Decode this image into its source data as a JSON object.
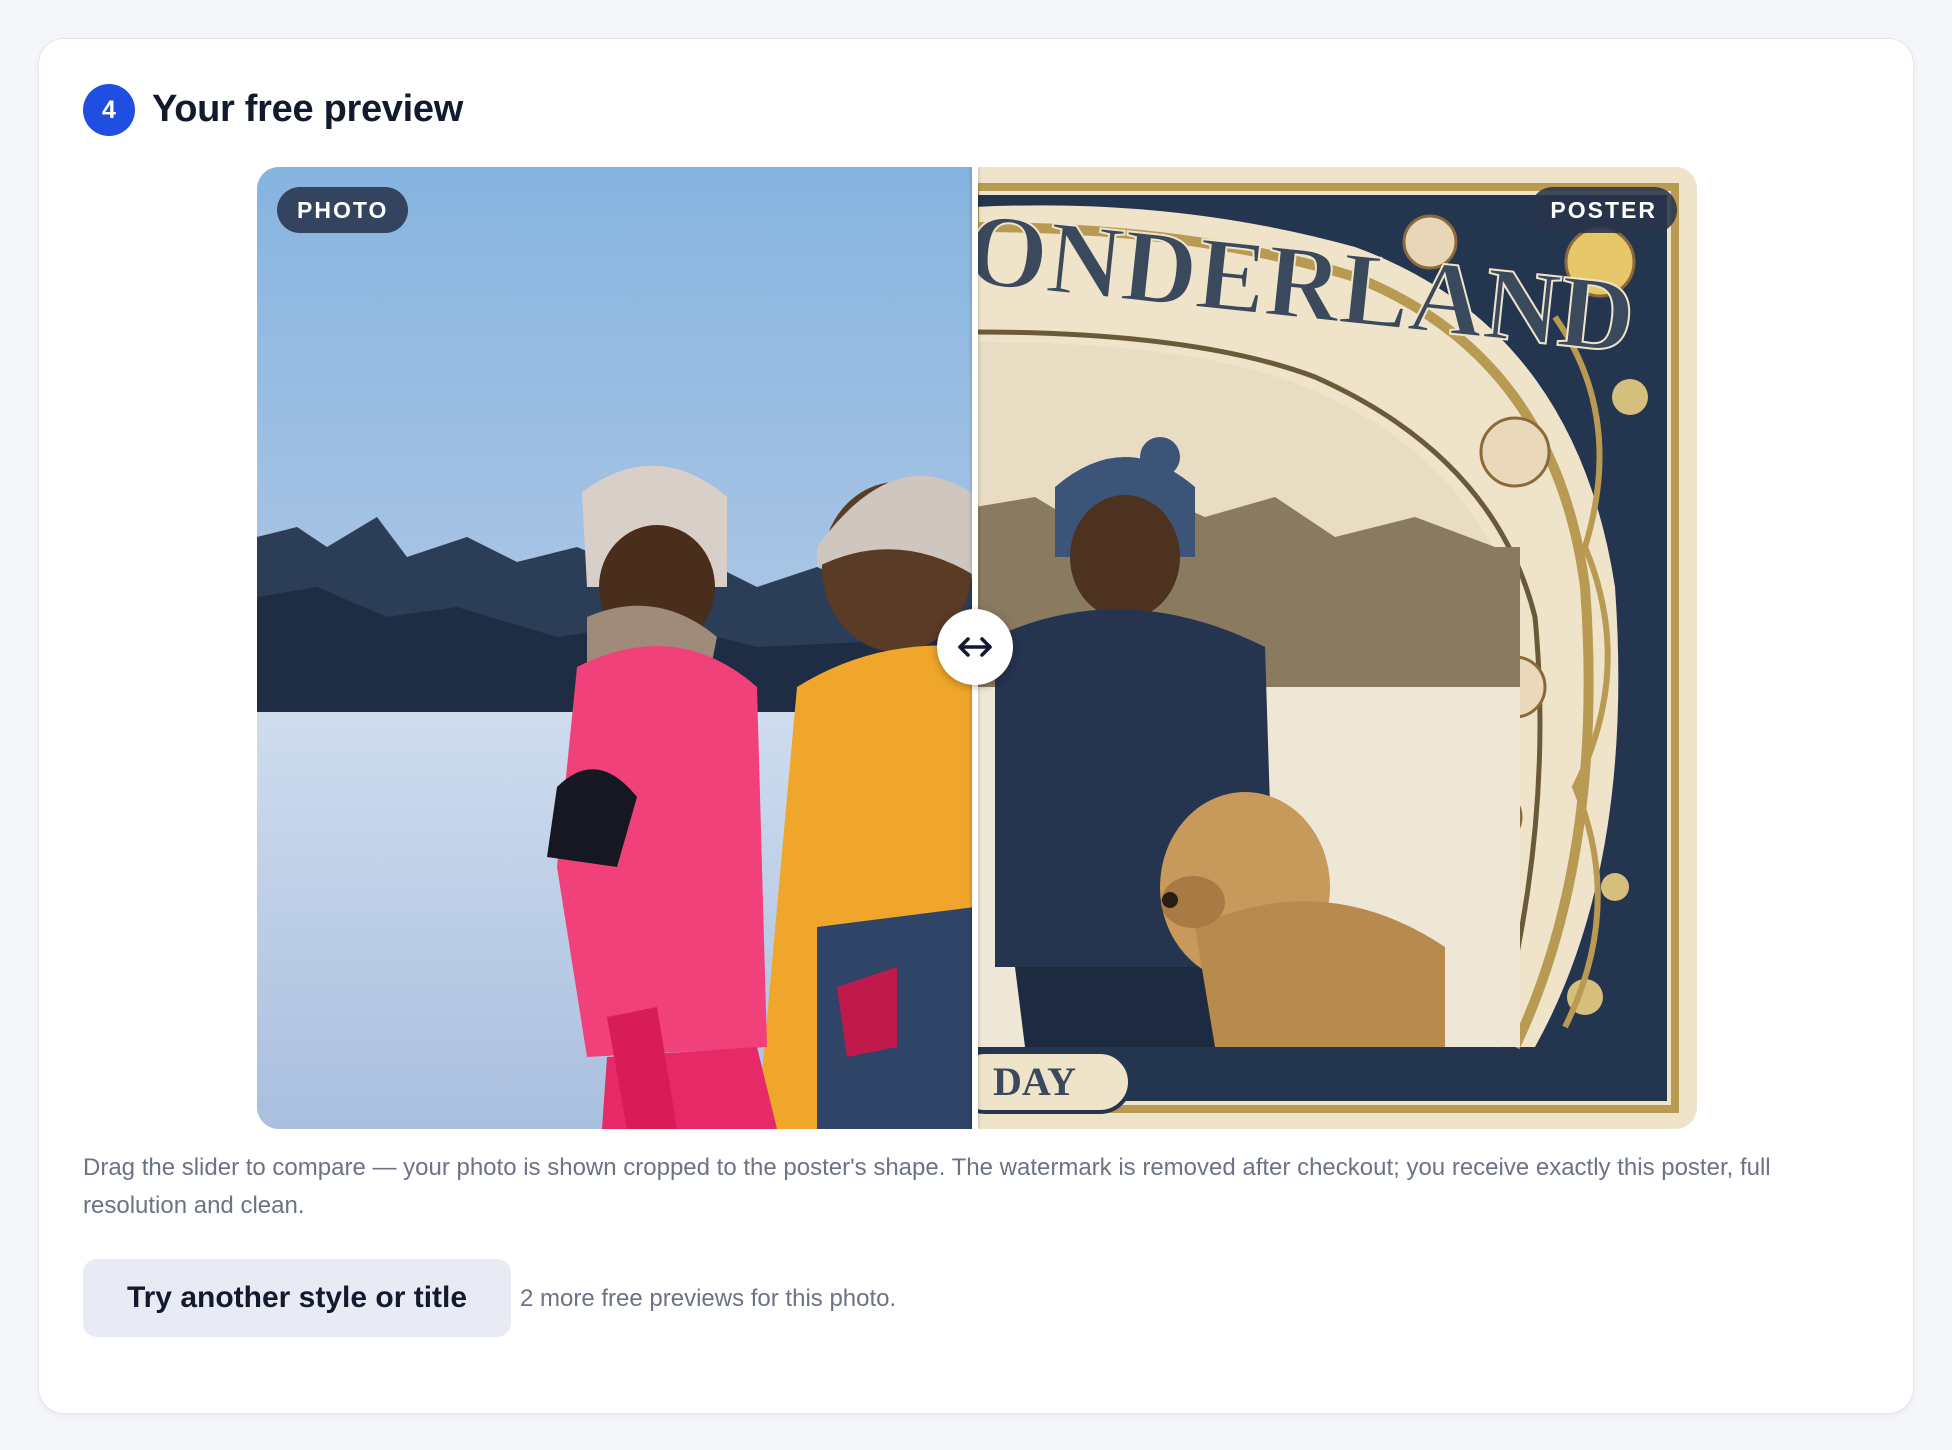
{
  "step": {
    "number": "4",
    "title": "Your free preview"
  },
  "compare": {
    "before_label": "PHOTO",
    "after_label": "POSTER",
    "split_percent": 50,
    "poster_text_top": "ONDERLAND",
    "poster_text_bottom": "DAY"
  },
  "caption": "Drag the slider to compare — your photo is shown cropped to the poster's shape. The watermark is removed after checkout; you receive exactly this poster, full resolution and clean.",
  "actions": {
    "retry_label": "Try another style or title",
    "remaining_text": "2 more free previews for this photo."
  },
  "colors": {
    "accent": "#1e4fe0",
    "poster_navy": "#243550",
    "poster_gold": "#b99a52"
  }
}
